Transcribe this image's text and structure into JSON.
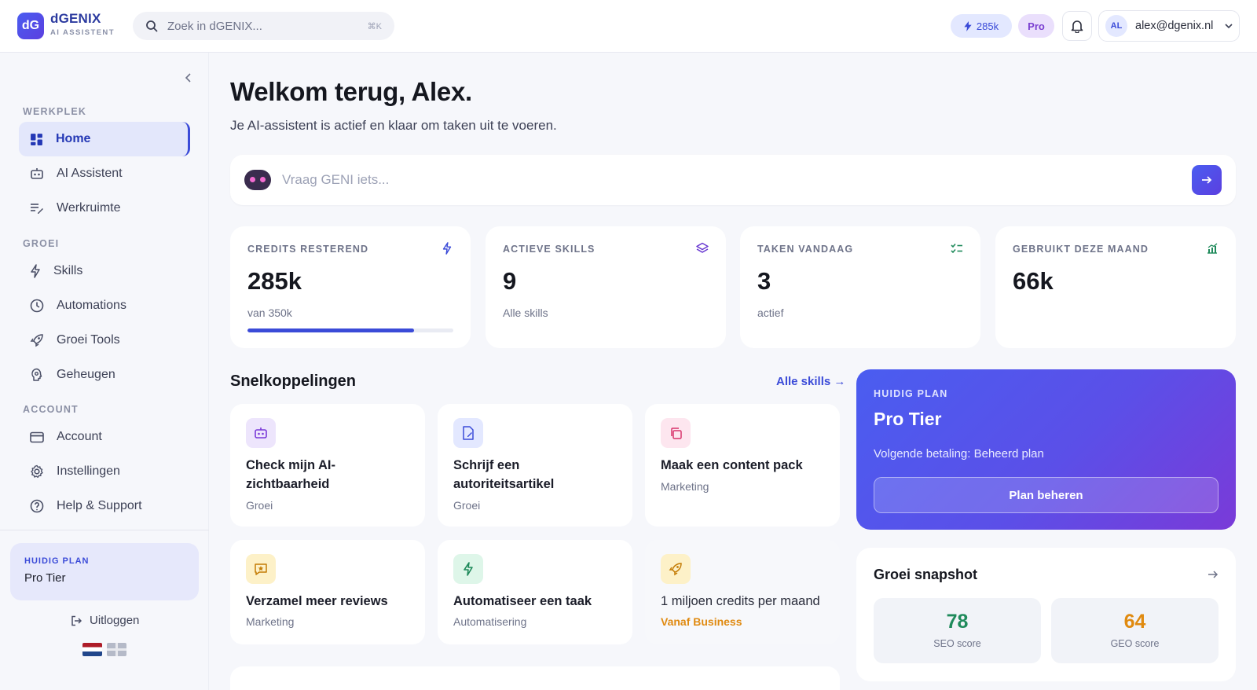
{
  "header": {
    "logo_text": "dG",
    "brand_name": "dGENIX",
    "brand_sub": "AI ASSISTENT",
    "search_placeholder": "Zoek in dGENIX...",
    "search_shortcut": "⌘K",
    "credits_badge": "285k",
    "plan_badge": "Pro",
    "user_initials": "AL",
    "user_email": "alex@dgenix.nl"
  },
  "sidebar": {
    "sections": {
      "werkplek": "WERKPLEK",
      "groei": "GROEI",
      "account": "ACCOUNT"
    },
    "items": [
      {
        "label": "Home",
        "icon": "grid-icon",
        "active": true
      },
      {
        "label": "AI Assistent",
        "icon": "robot-icon"
      },
      {
        "label": "Werkruimte",
        "icon": "list-edit-icon"
      },
      {
        "label": "Skills",
        "icon": "bolt-icon"
      },
      {
        "label": "Automations",
        "icon": "clock-icon"
      },
      {
        "label": "Groei Tools",
        "icon": "rocket-icon"
      },
      {
        "label": "Geheugen",
        "icon": "brain-icon"
      },
      {
        "label": "Account",
        "icon": "card-icon"
      },
      {
        "label": "Instellingen",
        "icon": "gear-icon"
      },
      {
        "label": "Help & Support",
        "icon": "help-icon"
      }
    ],
    "plan_caption": "HUIDIG PLAN",
    "plan_name": "Pro Tier",
    "logout": "Uitloggen"
  },
  "main": {
    "title": "Welkom terug, Alex.",
    "subtitle": "Je AI-assistent is actief en klaar om taken uit te voeren.",
    "ask_placeholder": "Vraag GENI iets...",
    "stats": [
      {
        "caption": "CREDITS RESTEREND",
        "value": "285k",
        "sub": "van 350k",
        "progress": 0.81
      },
      {
        "caption": "ACTIEVE SKILLS",
        "value": "9",
        "sub": "Alle skills"
      },
      {
        "caption": "TAKEN VANDAAG",
        "value": "3",
        "sub": "actief"
      },
      {
        "caption": "GEBRUIKT DEZE MAAND",
        "value": "66k",
        "sub": ""
      }
    ],
    "shortcuts_title": "Snelkoppelingen",
    "shortcuts_link": "Alle skills →",
    "shortcuts": [
      {
        "title": "Check mijn AI-zichtbaarheid",
        "sub": "Groei"
      },
      {
        "title": "Schrijf een autoriteitsartikel",
        "sub": "Groei"
      },
      {
        "title": "Maak een content pack",
        "sub": "Marketing"
      },
      {
        "title": "Verzamel meer reviews",
        "sub": "Marketing"
      },
      {
        "title": "Automatiseer een taak",
        "sub": "Automatisering"
      },
      {
        "title": "1 miljoen credits per maand",
        "sub": "Vanaf Business"
      }
    ],
    "plan_card": {
      "caption": "HUIDIG PLAN",
      "tier": "Pro Tier",
      "next_payment": "Volgende betaling: Beheerd plan",
      "button": "Plan beheren"
    },
    "snapshot": {
      "title": "Groei snapshot",
      "scores": [
        {
          "value": "78",
          "label": "SEO score",
          "color": "#1f8a5b"
        },
        {
          "value": "64",
          "label": "GEO score",
          "color": "#e08a10"
        }
      ]
    }
  },
  "colors": {
    "accent": "#3b4bd8",
    "accent_purple": "#7a3ad8",
    "upsell": "#e08a10"
  }
}
